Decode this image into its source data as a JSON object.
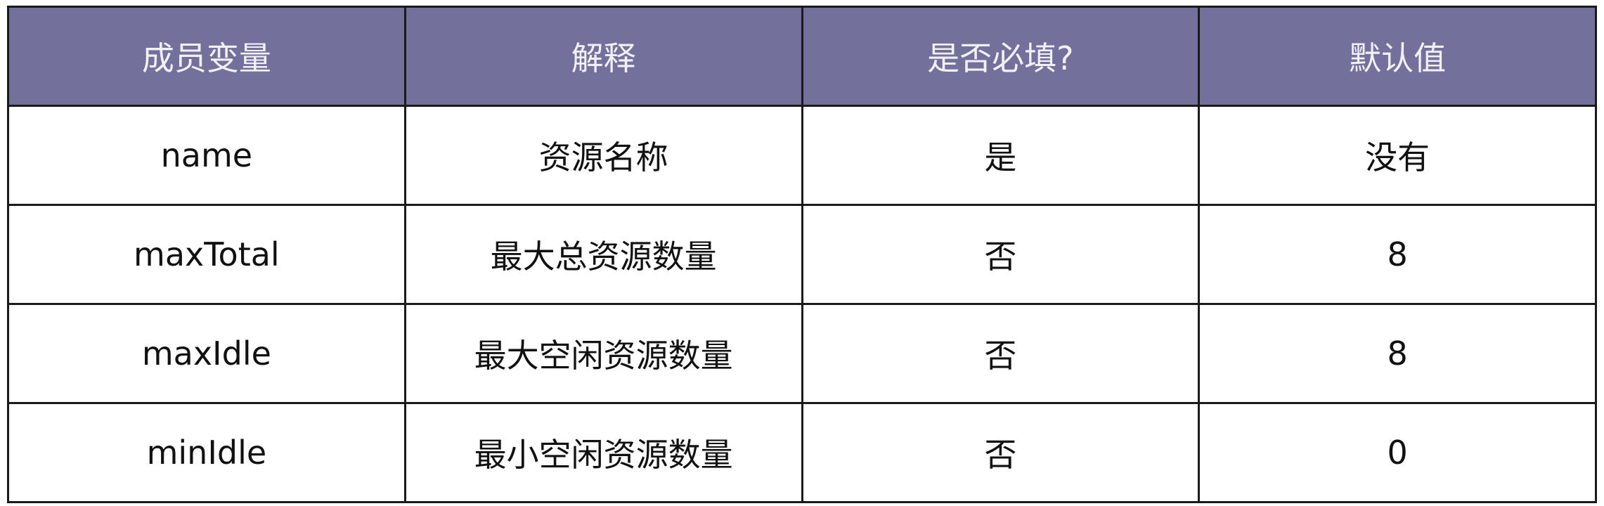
{
  "table": {
    "columns": [
      "成员变量",
      "解释",
      "是否必填?",
      "默认值"
    ],
    "rows": [
      [
        "name",
        "资源名称",
        "是",
        "没有"
      ],
      [
        "maxTotal",
        "最大总资源数量",
        "否",
        "8"
      ],
      [
        "maxIdle",
        "最大空闲资源数量",
        "否",
        "8"
      ],
      [
        "minIdle",
        "最小空闲资源数量",
        "否",
        "0"
      ]
    ]
  },
  "colors": {
    "header_background": "#74709c",
    "header_text": "#f1eff8",
    "border": "#1a1a1a",
    "cell_background": "#ffffff"
  }
}
